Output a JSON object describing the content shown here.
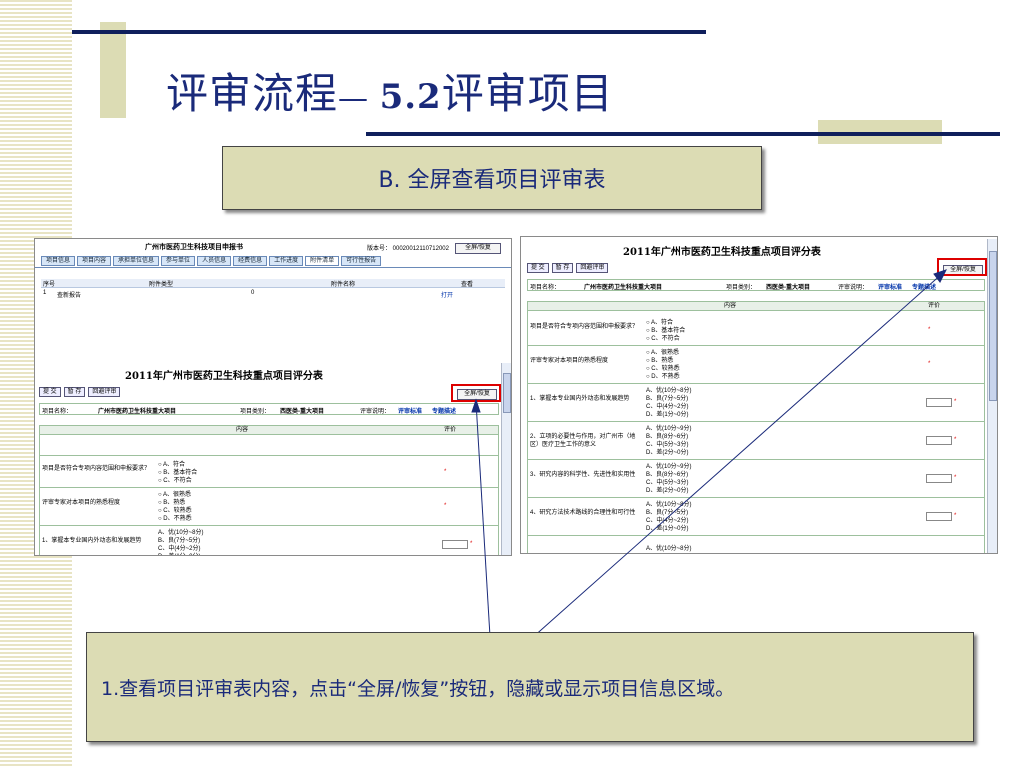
{
  "slide": {
    "title_main": "评审流程",
    "title_dash": "— ",
    "title_num": "5.2",
    "title_tail": "评审项目",
    "subtitle": "B. 全屏查看项目评审表",
    "callout": "1.查看项目评审表内容，点击“全屏/恢复”按钮，隐藏或显示项目信息区域。"
  },
  "left": {
    "app_title": "广州市医药卫生科技项目申报书",
    "version": "版本号： 00020012110712002",
    "fullscreen_btn": "全屏/恢复",
    "tabs": [
      "项目信息",
      "项目内容",
      "承担单位信息",
      "参与单位",
      "人员信息",
      "经费信息",
      "工作进度",
      "附件清单",
      "可行性报告"
    ],
    "active_tab": 7,
    "attach_table": {
      "headers": [
        "序号",
        "附件类型",
        "附件名称",
        "查看"
      ],
      "rows": [
        [
          "1",
          "查新报告",
          "0",
          "打开"
        ]
      ]
    },
    "sheet_title": "2011年广州市医药卫生科技重点项目评分表",
    "buttons": [
      "提 交",
      "暂 存",
      "回避评审"
    ],
    "fullscreen_btn2": "全屏/恢复",
    "info": {
      "name_label": "项目名称：",
      "name": "广州市医药卫生科技重大项目",
      "cat_label": "项目类别：",
      "cat": "西医类-重大项目",
      "note_label": "评审说明：",
      "link1": "评审标准",
      "link2": "专题描述"
    },
    "table_headers": [
      "内容",
      "评价"
    ],
    "questions": [
      {
        "q": "项目是否符合专项内容范围和申报要求？",
        "opts": [
          "A、符合",
          "B、基本符合",
          "C、不符合"
        ]
      },
      {
        "q": "评审专家对本项目的熟悉程度",
        "opts": [
          "A、很熟悉",
          "B、熟悉",
          "C、较熟悉",
          "D、不熟悉"
        ]
      },
      {
        "q": "1、掌握本专业国内外动态和发展趋势",
        "opts": [
          "A、优(10分~8分)",
          "B、良(7分~5分)",
          "C、中(4分~2分)",
          "D、差(1分~0分)"
        ]
      }
    ]
  },
  "right": {
    "sheet_title": "2011年广州市医药卫生科技重点项目评分表",
    "buttons": [
      "提 交",
      "暂 存",
      "回避评审"
    ],
    "fullscreen_btn": "全屏/恢复",
    "info": {
      "name_label": "项目名称：",
      "name": "广州市医药卫生科技重大项目",
      "cat_label": "项目类别：",
      "cat": "西医类-重大项目",
      "note_label": "评审说明：",
      "link1": "评审标准",
      "link2": "专题描述"
    },
    "table_headers": [
      "内容",
      "评价"
    ],
    "questions": [
      {
        "q": "项目是否符合专项内容范围和申报要求？",
        "opts": [
          "A、符合",
          "B、基本符合",
          "C、不符合"
        ]
      },
      {
        "q": "评审专家对本项目的熟悉程度",
        "opts": [
          "A、很熟悉",
          "B、熟悉",
          "C、较熟悉",
          "D、不熟悉"
        ]
      },
      {
        "q": "1、掌握本专业国内外动态和发展趋势",
        "opts": [
          "A、优(10分~8分)",
          "B、良(7分~5分)",
          "C、中(4分~2分)",
          "D、差(1分~0分)"
        ]
      },
      {
        "q": "2、立项的必要性与作用，对广州市（地区）医疗卫生工作的意义",
        "opts": [
          "A、优(10分~9分)",
          "B、良(8分~6分)",
          "C、中(5分~3分)",
          "D、差(2分~0分)"
        ]
      },
      {
        "q": "3、研究内容的科学性、先进性和实用性",
        "opts": [
          "A、优(10分~9分)",
          "B、良(8分~6分)",
          "C、中(5分~3分)",
          "D、差(2分~0分)"
        ]
      },
      {
        "q": "4、研究方法技术路线的合理性和可行性",
        "opts": [
          "A、优(10分~8分)",
          "B、良(7分~5分)",
          "C、中(4分~2分)",
          "D、差(1分~0分)"
        ]
      }
    ],
    "last_opt": "A、优(10分~8分)"
  },
  "colors": {
    "navy": "#0f1f5c",
    "khaki": "#dcdcb4",
    "red": "#dd0000",
    "title": "#1a2a7a"
  }
}
